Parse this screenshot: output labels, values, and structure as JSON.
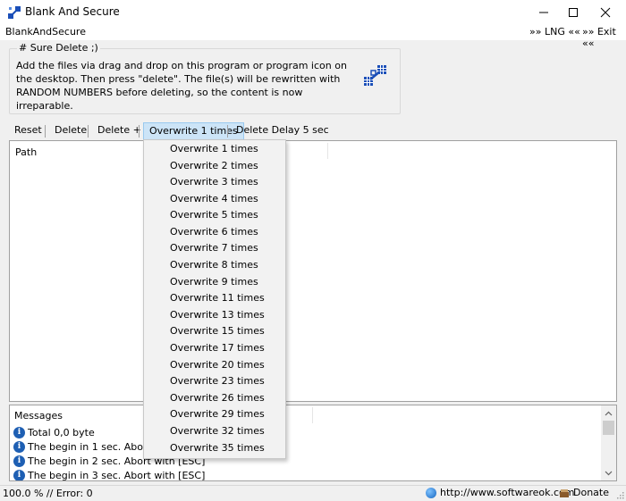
{
  "window": {
    "title": "Blank And Secure"
  },
  "menubar": {
    "app_name": "BlankAndSecure",
    "lng_label": "»» LNG ««",
    "exit_label": "»» Exit ««"
  },
  "group": {
    "legend": "# Sure Delete ;)",
    "description": "Add the files via drag and drop on this program or program icon on the desktop. Then press \"delete\". The file(s) will be rewritten with RANDOM NUMBERS before deleting, so the content is now irreparable."
  },
  "toolbar": {
    "reset": "Reset",
    "delete": "Delete",
    "delete_plus": "Delete +",
    "overwrite": "Overwrite 1 times",
    "delay": "Delete Delay 5 sec"
  },
  "path_panel": {
    "header": "Path"
  },
  "messages": {
    "header": "Messages",
    "items": [
      "Total 0,0 byte",
      "The begin in 1 sec. Abort with [ESC]",
      "The begin in 2 sec. Abort with [ESC]",
      "The begin in 3 sec. Abort with [ESC]"
    ]
  },
  "dropdown": {
    "options": [
      "Overwrite 1 times",
      "Overwrite 2 times",
      "Overwrite 3 times",
      "Overwrite 4 times",
      "Overwrite 5 times",
      "Overwrite 6 times",
      "Overwrite 7 times",
      "Overwrite 8 times",
      "Overwrite 9 times",
      "Overwrite 11 times",
      "Overwrite 13 times",
      "Overwrite 15 times",
      "Overwrite 17 times",
      "Overwrite 20 times",
      "Overwrite 23 times",
      "Overwrite 26 times",
      "Overwrite 29 times",
      "Overwrite 32 times",
      "Overwrite 35 times"
    ]
  },
  "status": {
    "text": "100.0 % // Error: 0",
    "url": "http://www.softwareok.com",
    "donate": "Donate"
  },
  "icons": {
    "app": "blank-and-secure-icon",
    "minimize": "minimize-icon",
    "maximize": "maximize-icon",
    "close": "close-icon",
    "info": "info-icon",
    "globe": "globe-icon",
    "donate": "donate-icon"
  }
}
